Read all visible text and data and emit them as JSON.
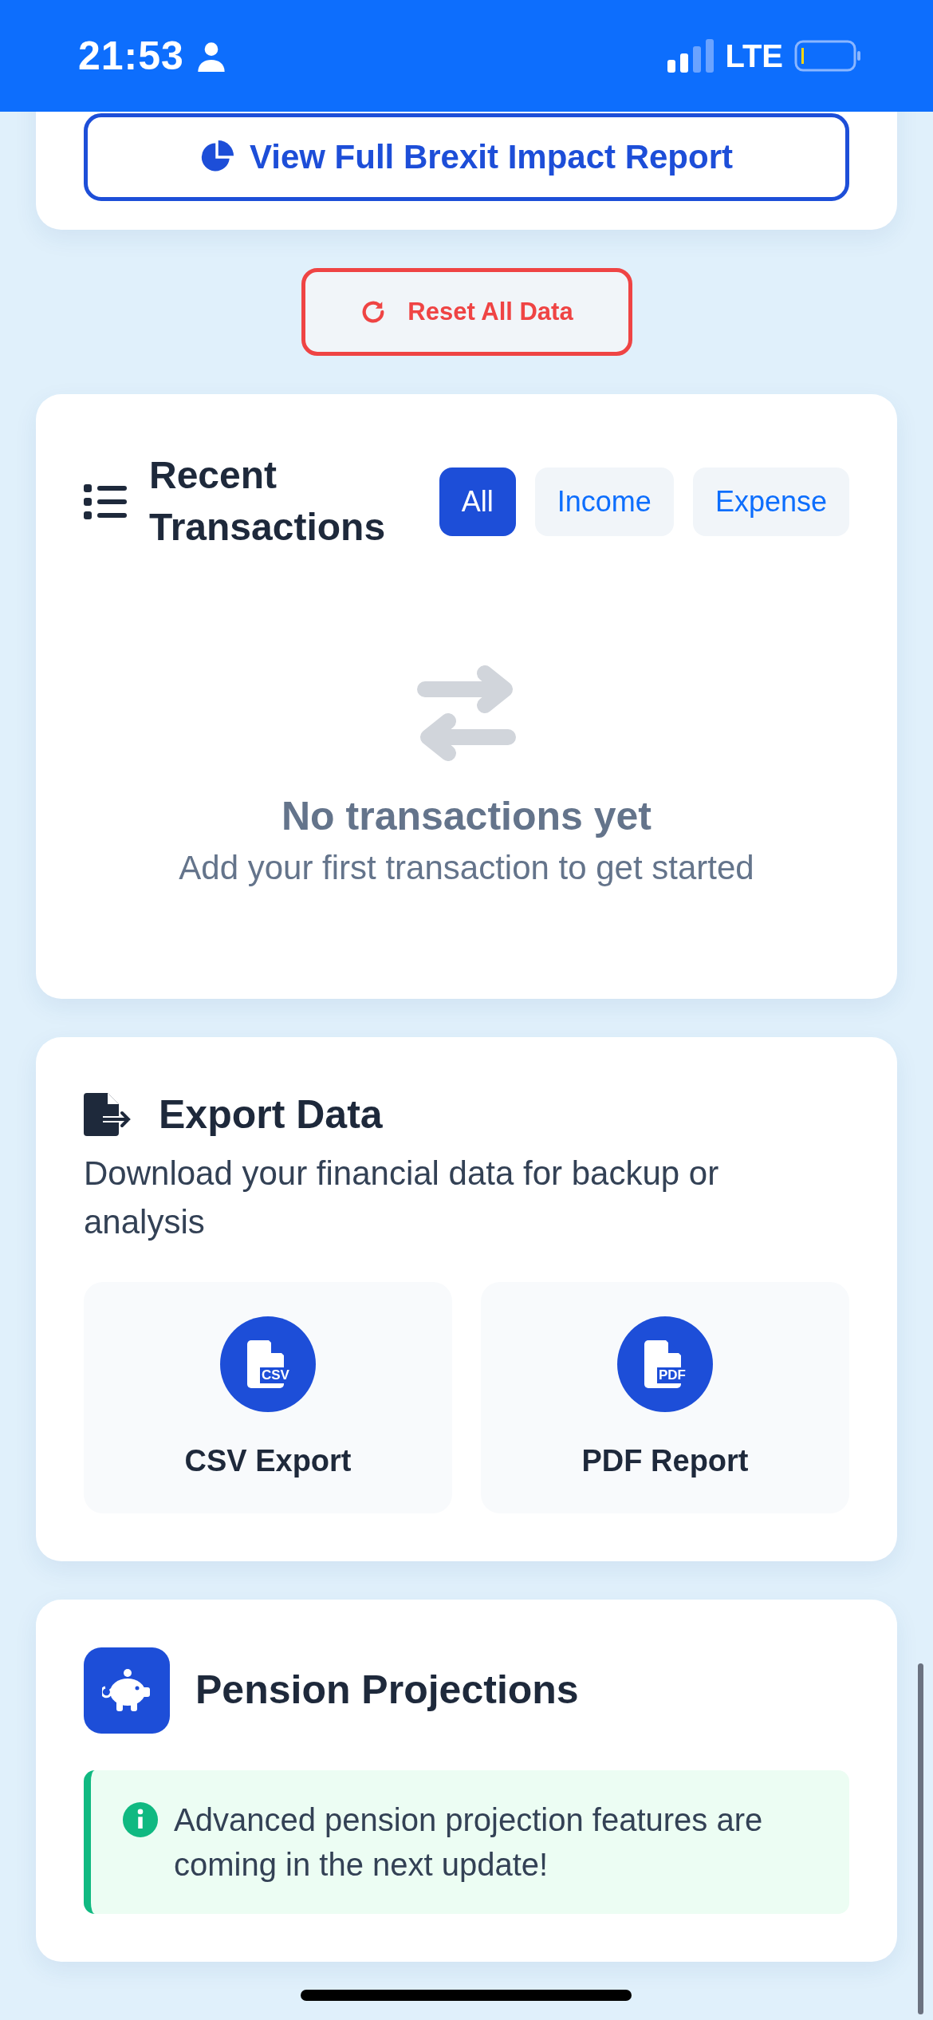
{
  "status_bar": {
    "time": "21:53",
    "network": "LTE"
  },
  "brexit_button": {
    "label": "View Full Brexit Impact Report"
  },
  "reset_button": {
    "label": "Reset All Data"
  },
  "transactions": {
    "title": "Recent Transactions",
    "filters": [
      {
        "label": "All",
        "selected": true
      },
      {
        "label": "Income",
        "selected": false
      },
      {
        "label": "Expense",
        "selected": false
      }
    ],
    "empty_title": "No transactions yet",
    "empty_message": "Add your first transaction to get started"
  },
  "export": {
    "title": "Export Data",
    "description": "Download your financial data for backup or analysis",
    "options": [
      {
        "label": "CSV Export",
        "file_type": "CSV"
      },
      {
        "label": "PDF Report",
        "file_type": "PDF"
      }
    ]
  },
  "pension": {
    "title": "Pension Projections",
    "notice": "Advanced pension projection features are coming in the next update!"
  }
}
